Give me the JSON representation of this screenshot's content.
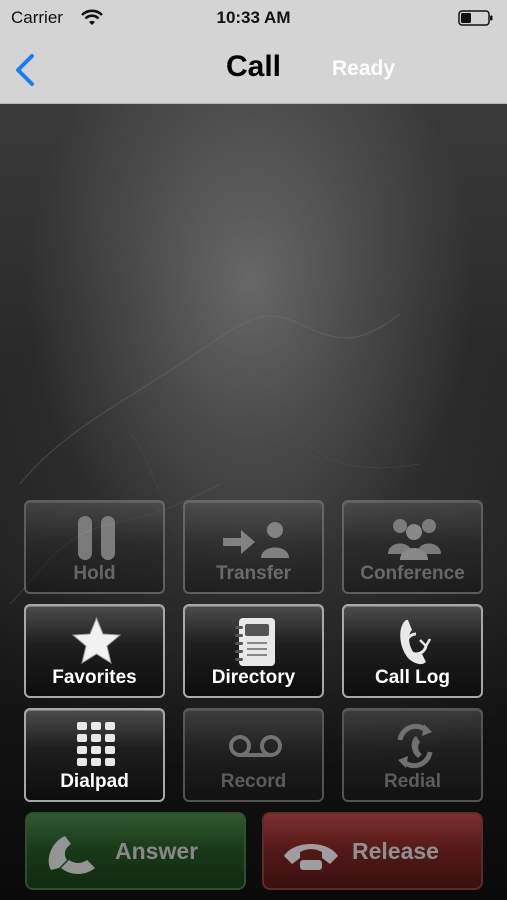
{
  "status_bar": {
    "carrier": "Carrier",
    "time": "10:33 AM"
  },
  "nav": {
    "title": "Call",
    "status": "Ready"
  },
  "buttons": [
    {
      "label": "Hold",
      "icon": "pause-icon",
      "enabled": false
    },
    {
      "label": "Transfer",
      "icon": "transfer-icon",
      "enabled": false
    },
    {
      "label": "Conference",
      "icon": "conference-icon",
      "enabled": false
    },
    {
      "label": "Favorites",
      "icon": "star-icon",
      "enabled": true
    },
    {
      "label": "Directory",
      "icon": "address-book-icon",
      "enabled": true
    },
    {
      "label": "Call Log",
      "icon": "call-log-icon",
      "enabled": true
    },
    {
      "label": "Dialpad",
      "icon": "dialpad-icon",
      "enabled": true
    },
    {
      "label": "Record",
      "icon": "voicemail-icon",
      "enabled": false
    },
    {
      "label": "Redial",
      "icon": "redial-icon",
      "enabled": false
    }
  ],
  "answer": {
    "label": "Answer",
    "icon": "phone-icon",
    "enabled": false
  },
  "release": {
    "label": "Release",
    "icon": "hangup-icon",
    "enabled": false
  },
  "colors": {
    "nav_bg": "#d4d4d4",
    "back_accent": "#1a7cf5",
    "answer": "#1f4d20",
    "release": "#6c1d1d"
  }
}
